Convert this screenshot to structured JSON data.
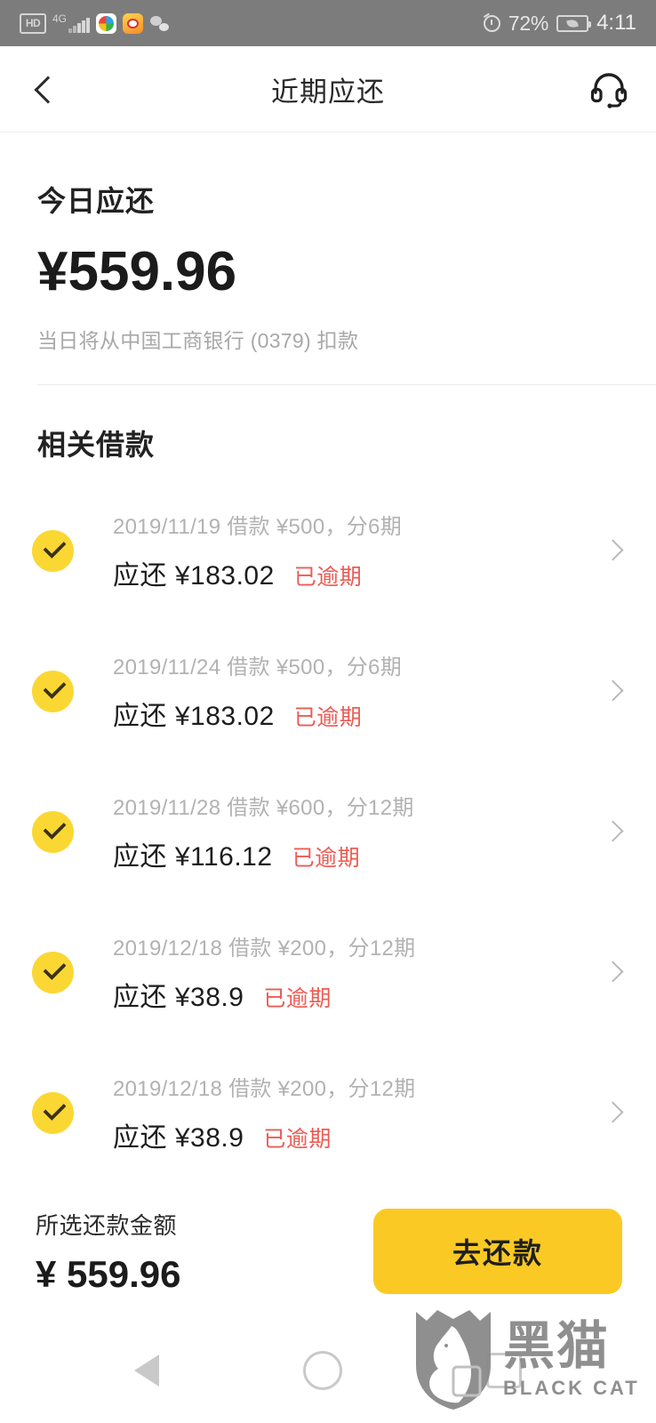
{
  "status_bar": {
    "hd_label": "HD",
    "network_label": "4G",
    "signal_icon": "signal-bars-icon",
    "app_icons": [
      "sogou-app-icon",
      "weibo-app-icon",
      "wechat-app-icon"
    ],
    "alarm_icon": "alarm-clock-icon",
    "battery_percent": "72%",
    "battery_icon": "battery-saver-icon",
    "time": "4:11"
  },
  "header": {
    "back_icon": "back-chevron-icon",
    "title": "近期应还",
    "support_icon": "headset-icon"
  },
  "today": {
    "label": "今日应还",
    "amount": "¥559.96",
    "note": "当日将从中国工商银行 (0379) 扣款"
  },
  "loans_section": {
    "title": "相关借款",
    "items": [
      {
        "meta": "2019/11/19 借款 ¥500，分6期",
        "due_label": "应还 ¥183.02",
        "status": "已逾期",
        "checked": true
      },
      {
        "meta": "2019/11/24 借款 ¥500，分6期",
        "due_label": "应还 ¥183.02",
        "status": "已逾期",
        "checked": true
      },
      {
        "meta": "2019/11/28 借款 ¥600，分12期",
        "due_label": "应还 ¥116.12",
        "status": "已逾期",
        "checked": true
      },
      {
        "meta": "2019/12/18 借款 ¥200，分12期",
        "due_label": "应还 ¥38.9",
        "status": "已逾期",
        "checked": true
      },
      {
        "meta": "2019/12/18 借款 ¥200，分12期",
        "due_label": "应还 ¥38.9",
        "status": "已逾期",
        "checked": true
      }
    ]
  },
  "bottom_bar": {
    "selected_label": "所选还款金额",
    "selected_amount": "¥ 559.96",
    "pay_button_label": "去还款"
  },
  "nav_bar": {
    "back_icon": "nav-back-icon",
    "home_icon": "nav-home-icon",
    "recents_icon": "nav-recents-icon"
  },
  "watermark": {
    "cn": "黑猫",
    "en": "BLACK CAT",
    "logo_icon": "black-cat-shield-icon"
  },
  "colors": {
    "accent_yellow": "#FBC924",
    "check_yellow": "#FBD733",
    "overdue_red": "#ec5b53",
    "status_bar_gray": "#7c7c7c",
    "muted_text": "#b2b2b2"
  }
}
